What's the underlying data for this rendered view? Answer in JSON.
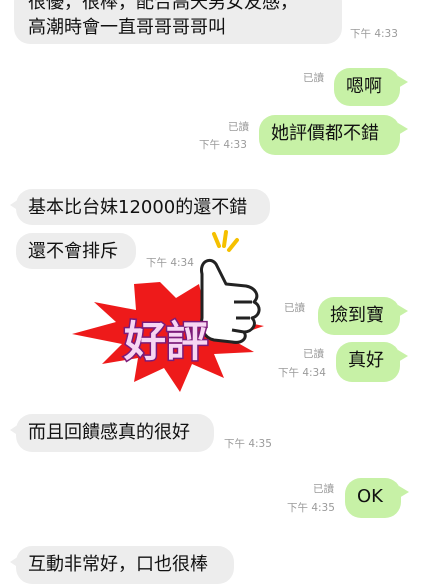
{
  "messages": [
    {
      "side": "in",
      "lines": [
        "很優，很棒，配合高天男女友感，",
        "高潮時會一直哥哥哥哥叫"
      ],
      "time": "下午 4:33"
    },
    {
      "side": "out",
      "text": "嗯啊",
      "read": "已讀"
    },
    {
      "side": "out",
      "text": "她評價都不錯",
      "read": "已讀",
      "time": "下午 4:33"
    },
    {
      "side": "in",
      "text": "基本比台妹12000的還不錯"
    },
    {
      "side": "in",
      "text": "還不會排斥",
      "time": "下午 4:34"
    },
    {
      "side": "out",
      "text": "撿到寶",
      "read": "已讀"
    },
    {
      "side": "out",
      "text": "真好",
      "read": "已讀",
      "time": "下午 4:34"
    },
    {
      "side": "in",
      "text": "而且回饋感真的很好",
      "time": "下午 4:35"
    },
    {
      "side": "out",
      "text": "OK",
      "read": "已讀",
      "time": "下午 4:35"
    },
    {
      "side": "in",
      "text": "互動非常好，口也很棒"
    }
  ],
  "stamp": {
    "text": "好評",
    "burst_color": "#ee1a1a",
    "text_color": "#f7d6f3",
    "outline_color": "#7a1b7a",
    "spark_color": "#f5c000"
  },
  "colors": {
    "incoming_bubble": "#ededed",
    "outgoing_bubble": "#c7f1a6",
    "meta_text": "#9a9a9a"
  }
}
